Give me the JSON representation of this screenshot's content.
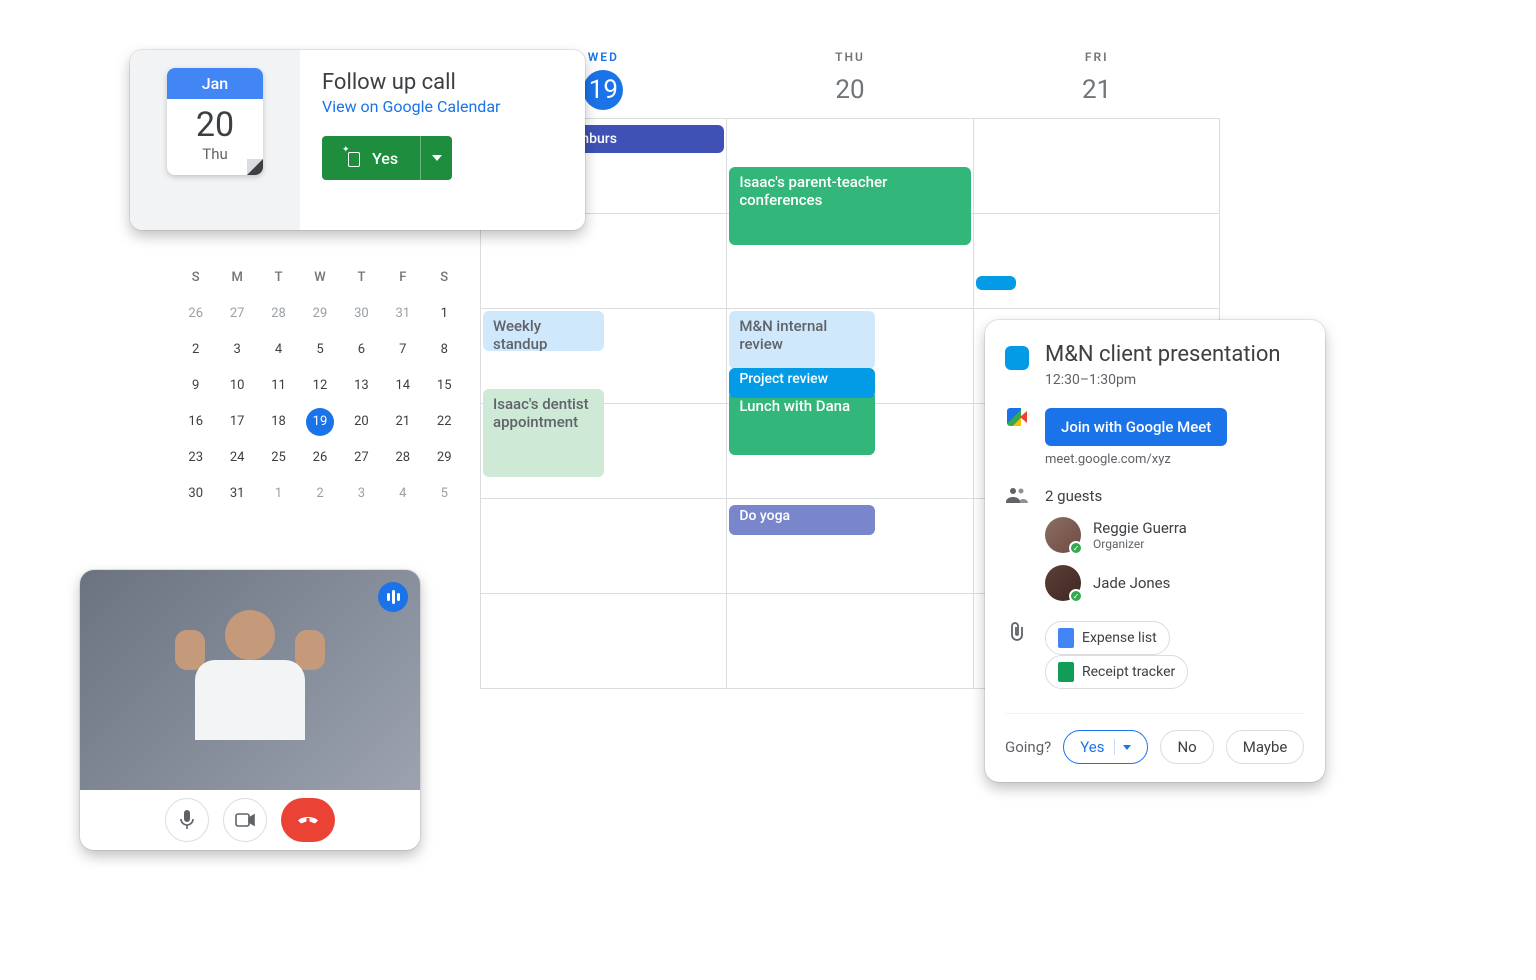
{
  "followUp": {
    "month": "Jan",
    "day": "20",
    "dow": "Thu",
    "title": "Follow up call",
    "link": "View on Google Calendar",
    "yes": "Yes"
  },
  "miniMonth": {
    "dow": [
      "S",
      "M",
      "T",
      "W",
      "T",
      "F",
      "S"
    ],
    "grid": [
      [
        "26",
        "27",
        "28",
        "29",
        "30",
        "31",
        "1"
      ],
      [
        "2",
        "3",
        "4",
        "5",
        "6",
        "7",
        "8"
      ],
      [
        "9",
        "10",
        "11",
        "12",
        "13",
        "14",
        "15"
      ],
      [
        "16",
        "17",
        "18",
        "19",
        "20",
        "21",
        "22"
      ],
      [
        "23",
        "24",
        "25",
        "26",
        "27",
        "28",
        "29"
      ],
      [
        "30",
        "31",
        "1",
        "2",
        "3",
        "4",
        "5"
      ]
    ],
    "today": "19"
  },
  "week": {
    "columns": [
      {
        "dow": "WED",
        "num": "19",
        "active": true
      },
      {
        "dow": "THU",
        "num": "20",
        "active": false
      },
      {
        "dow": "FRI",
        "num": "21",
        "active": false
      }
    ]
  },
  "events": {
    "submit": "Submit reimburs",
    "isaac_conf": "Isaac's parent-teacher conferences",
    "standup": "Weekly standup",
    "mn_review": "M&N internal review",
    "isaac_dentist": "Isaac's dentist appointment",
    "lunch": "Lunch with Dana",
    "project": "Project review",
    "yoga": "Do yoga"
  },
  "detail": {
    "title": "M&N client presentation",
    "time": "12:30–1:30pm",
    "join": "Join with Google Meet",
    "url": "meet.google.com/xyz",
    "guests_label": "2 guests",
    "guests": [
      {
        "name": "Reggie Guerra",
        "role": "Organizer"
      },
      {
        "name": "Jade Jones",
        "role": ""
      }
    ],
    "attachments": [
      {
        "label": "Expense list",
        "color": "#4285f4"
      },
      {
        "label": "Receipt tracker",
        "color": "#0f9d58"
      }
    ],
    "going": "Going?",
    "rsvp": {
      "yes": "Yes",
      "no": "No",
      "maybe": "Maybe"
    }
  }
}
